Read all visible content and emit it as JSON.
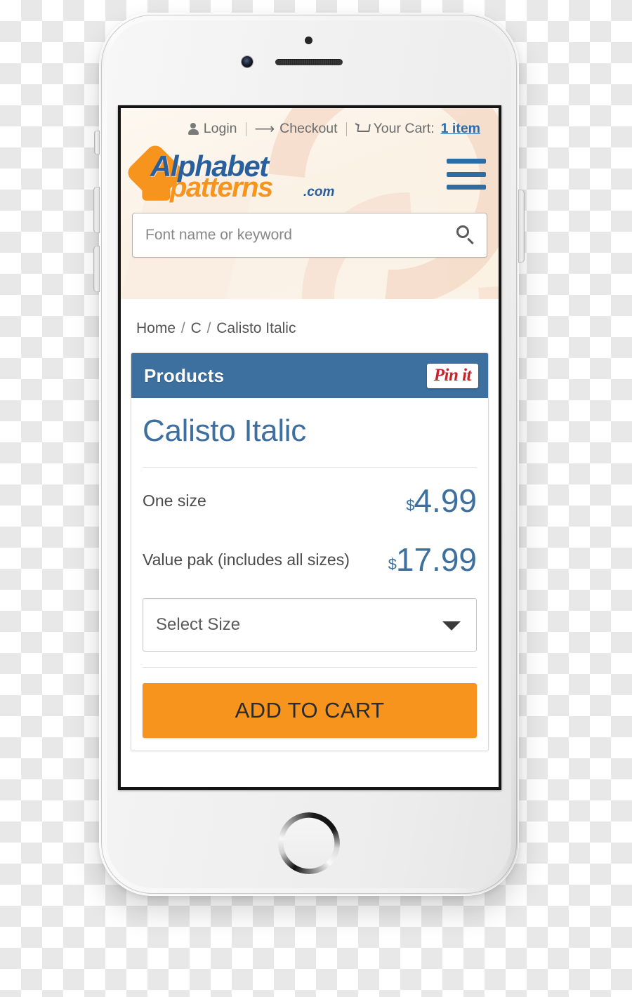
{
  "device": {
    "type": "smartphone-mockup",
    "frame_color": "#f2f2f2"
  },
  "site": {
    "topnav": {
      "login_label": "Login",
      "login_icon": "user-icon",
      "checkout_label": "Checkout",
      "checkout_icon": "arrow-right-icon",
      "cart_icon": "shopping-cart-icon",
      "cart_label": "Your Cart:",
      "cart_count": "1 item"
    },
    "logo": {
      "word1": "Alphabet",
      "word2": "patterns",
      "tld": ".com",
      "word1_color": "#2a5f9e",
      "word2_color": "#f7941d"
    },
    "menu_icon": "hamburger-menu-icon",
    "search": {
      "placeholder": "Font name or keyword",
      "value": "",
      "icon": "search-icon"
    }
  },
  "breadcrumb": {
    "items": [
      "Home",
      "C",
      "Calisto Italic"
    ],
    "separator": "/"
  },
  "product_card": {
    "header_title": "Products",
    "header_color": "#3d6f9f",
    "pin_button_label": "Pin it",
    "pin_button_color": "#c8232c",
    "product_name": "Calisto Italic",
    "prices": [
      {
        "label": "One size",
        "currency": "$",
        "amount": "4.99"
      },
      {
        "label": "Value pak (includes all sizes)",
        "currency": "$",
        "amount": "17.99"
      }
    ],
    "size_select": {
      "selected": "Select Size",
      "caret_icon": "chevron-down-icon"
    },
    "add_to_cart_label": "ADD TO CART",
    "add_to_cart_color": "#f7941d"
  }
}
